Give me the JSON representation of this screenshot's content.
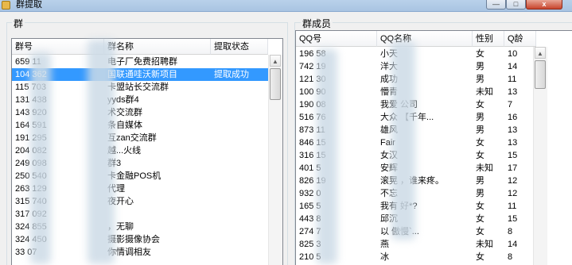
{
  "window": {
    "title": "群提取",
    "minimize_glyph": "—",
    "maximize_glyph": "□",
    "close_glyph": "x"
  },
  "groups_panel": {
    "label": "群",
    "columns": [
      "群号",
      "群名称",
      "提取状态"
    ],
    "rows": [
      {
        "id": "659   11",
        "name": "电子厂免费招聘群",
        "status": ""
      },
      {
        "id": "104   362",
        "name": "国联通哇沃新项目",
        "status": "提取成功"
      },
      {
        "id": "115   703",
        "name": "卡盟站长交流群",
        "status": ""
      },
      {
        "id": "131   438",
        "name": "yyds群4",
        "status": ""
      },
      {
        "id": "143   920",
        "name": "术交流群",
        "status": ""
      },
      {
        "id": "164   591",
        "name": "条自媒体",
        "status": ""
      },
      {
        "id": "191   295",
        "name": "互zan交流群",
        "status": ""
      },
      {
        "id": "204   082",
        "name": "越...火线",
        "status": ""
      },
      {
        "id": "249   098",
        "name": "群3",
        "status": ""
      },
      {
        "id": "250   540",
        "name": "卡金融POS机",
        "status": ""
      },
      {
        "id": "263   129",
        "name": "代理",
        "status": ""
      },
      {
        "id": "315   740",
        "name": "夜开心",
        "status": ""
      },
      {
        "id": "317   092",
        "name": "",
        "status": ""
      },
      {
        "id": "324   855",
        "name": "，无聊",
        "status": ""
      },
      {
        "id": "324   450",
        "name": "摄影摄像协会",
        "status": ""
      },
      {
        "id": "33    07",
        "name": "你情调相友",
        "status": ""
      }
    ]
  },
  "members_panel": {
    "label": "群成员",
    "columns": [
      "QQ号",
      "QQ名称",
      "性别",
      "Q龄"
    ],
    "rows": [
      {
        "qq": "196   58",
        "name": "小天",
        "gender": "女",
        "age": "10"
      },
      {
        "qq": "742   19",
        "name": "洋大",
        "gender": "男",
        "age": "14"
      },
      {
        "qq": "121   30",
        "name": "成功",
        "gender": "男",
        "age": "11"
      },
      {
        "qq": "100   90",
        "name": "懵青",
        "gender": "未知",
        "age": "13"
      },
      {
        "qq": "190   08",
        "name": "我爱   公司",
        "gender": "女",
        "age": "7"
      },
      {
        "qq": "516   76",
        "name": "大众   【千年...",
        "gender": "男",
        "age": "16"
      },
      {
        "qq": "873   11",
        "name": "雄风",
        "gender": "男",
        "age": "13"
      },
      {
        "qq": "846   15",
        "name": "Fair",
        "gender": "女",
        "age": "13"
      },
      {
        "qq": "316   15",
        "name": "女汉",
        "gender": "女",
        "age": "15"
      },
      {
        "qq": "401   5",
        "name": "安辉",
        "gender": "未知",
        "age": "17"
      },
      {
        "qq": "826   19",
        "name": "滚晃   ，谁来疼。",
        "gender": "男",
        "age": "12"
      },
      {
        "qq": "932   0",
        "name": "不忘",
        "gender": "男",
        "age": "12"
      },
      {
        "qq": "165   5",
        "name": "我有   好*?",
        "gender": "女",
        "age": "11"
      },
      {
        "qq": "443   8",
        "name": "邱沉",
        "gender": "女",
        "age": "15"
      },
      {
        "qq": "274   7",
        "name": "以   傲慢`...",
        "gender": "女",
        "age": "8"
      },
      {
        "qq": "825   3",
        "name": "燕",
        "gender": "未知",
        "age": "14"
      },
      {
        "qq": "210   5",
        "name": "冰",
        "gender": "女",
        "age": "8"
      }
    ]
  }
}
